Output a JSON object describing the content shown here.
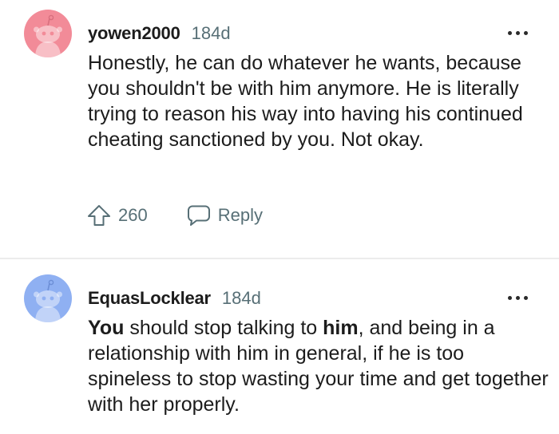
{
  "comments": [
    {
      "username": "yowen2000",
      "age": "184d",
      "avatar_color": "#f28b98",
      "body": "Honestly, he can do whatever he wants, because you shouldn't be with him anymore. He is literally trying to reason his way into having his continued cheating sanctioned by you. Not okay.",
      "upvotes": "260",
      "upvote_icon": "upvote-arrow-icon",
      "reply_label": "Reply",
      "reply_icon": "speech-bubble-icon",
      "more_icon": "more-options-icon"
    },
    {
      "username": "EquasLocklear",
      "age": "184d",
      "avatar_color": "#8fb0f2",
      "body_parts": [
        "You",
        " should stop talking to ",
        "him",
        ", and being in a relationship with him in general, if he is too spineless to stop wasting your time and get together with her properly."
      ],
      "more_icon": "more-options-icon"
    }
  ],
  "colors": {
    "text": "#1c1c1c",
    "meta": "#576f76",
    "divider": "#ececec",
    "background": "#ffffff"
  }
}
